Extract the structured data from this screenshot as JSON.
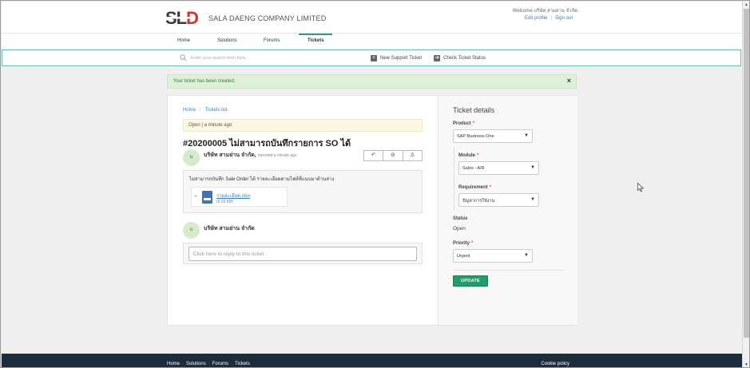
{
  "brand": {
    "logo_text": "SLD",
    "company_name": "SALA DAENG COMPANY LIMITED"
  },
  "user": {
    "welcome": "Welcome บริษัท สามย่าน จำกัด",
    "edit_profile": "Edit profile",
    "sign_out": "Sign out"
  },
  "nav": {
    "items": [
      "Home",
      "Solutions",
      "Forums",
      "Tickets"
    ],
    "active": "Tickets"
  },
  "search": {
    "placeholder": "Enter your search term here...",
    "new_ticket": "New Support Ticket",
    "check_status": "Check Ticket Status"
  },
  "alert": {
    "message": "Your ticket has been created.",
    "close": "×"
  },
  "ticket": {
    "breadcrumb": [
      "Home",
      "Tickets list"
    ],
    "status_line": "Open | a minute ago",
    "title": "#20200005 ไม่สามารถบันทึกรายการ SO ได้",
    "author": "บริษัท สามย่าน จำกัด",
    "author_meta": "reported a minute ago",
    "avatar_initial": "บ",
    "message": "ไม่สามารถบันทึก Sale Order ได้ รายละเอียดตามไฟล์ที่แนบมาด้านล่าง",
    "attachment": {
      "name": "รายละเอียด.xlsx",
      "size": "(6.03 KB)"
    },
    "reply_author": "บริษัท สามย่าน จำกัด",
    "reply_placeholder": "Click here to reply to this ticket"
  },
  "details": {
    "title": "Ticket details",
    "product_label": "Product",
    "product_value": "SAP Business One",
    "module_label": "Module",
    "module_value": "Sales - A/R",
    "requirement_label": "Requirement",
    "requirement_value": "ปัญหาการใช้งาน",
    "status_label": "Status",
    "status_value": "Open",
    "priority_label": "Priority",
    "priority_value": "Urgent",
    "update_button": "UPDATE",
    "required_mark": "*"
  },
  "footer": {
    "links": [
      "Home",
      "Solutions",
      "Forums",
      "Tickets"
    ],
    "cookie": "Cookie policy"
  },
  "colors": {
    "accent": "#1f9d6b",
    "footer_bg": "#1c2c3c",
    "alert_bg": "#dff0d8",
    "link": "#3b7bbf",
    "logo_red": "#d9322b"
  }
}
